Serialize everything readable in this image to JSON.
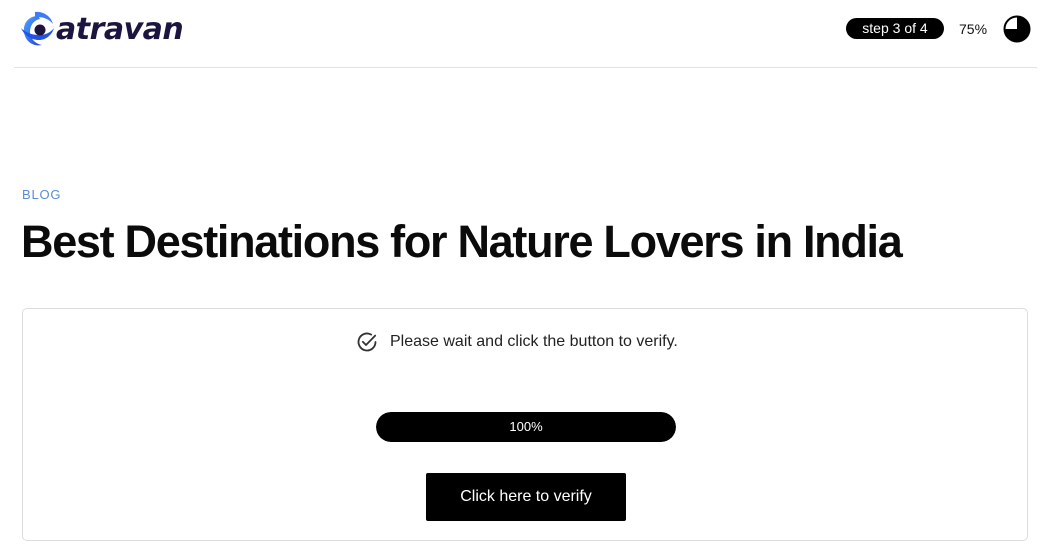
{
  "header": {
    "logo_text": "atravan",
    "step_label": "step 3 of 4",
    "progress_percent": "75%",
    "progress_fraction": 0.75
  },
  "article": {
    "category": "BLOG",
    "title": "Best Destinations for Nature Lovers in India"
  },
  "verify": {
    "notice": "Please wait and click the button to verify.",
    "progress_label": "100%",
    "progress_fraction": 1.0,
    "button_label": "Click here to verify"
  },
  "colors": {
    "brand_blue": "#2f6ff0",
    "logo_text": "#1c1540",
    "category": "#5b8dd6",
    "dark": "#000000"
  },
  "icons": {
    "logo": "atravan-swirl-logo",
    "step_progress": "pie-progress-icon",
    "notice": "check-circle-icon"
  }
}
